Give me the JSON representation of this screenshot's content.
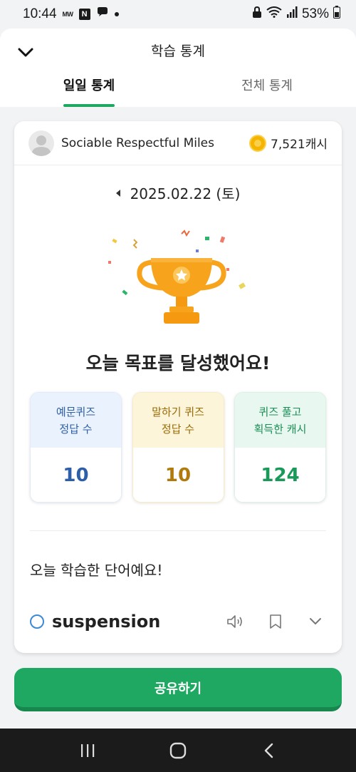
{
  "status_bar": {
    "time": "10:44",
    "mini_label": "MW",
    "n_badge": "N",
    "battery": "53%"
  },
  "header": {
    "title": "학습 통계",
    "tabs": [
      {
        "label": "일일 통계",
        "active": true
      },
      {
        "label": "전체 통계",
        "active": false
      }
    ]
  },
  "user": {
    "name": "Sociable Respectful Miles",
    "cash": "7,521캐시"
  },
  "date": "2025.02.22 (토)",
  "goal_message": "오늘 목표를 달성했어요!",
  "stats": [
    {
      "line1": "예문퀴즈",
      "line2": "정답 수",
      "value": "10",
      "color": "#2d5ea8"
    },
    {
      "line1": "말하기 퀴즈",
      "line2": "정답 수",
      "value": "10",
      "color": "#b07a0c"
    },
    {
      "line1": "퀴즈 풀고",
      "line2": "획득한 캐시",
      "value": "124",
      "color": "#1a9a5a"
    }
  ],
  "words_title": "오늘 학습한 단어예요!",
  "word": {
    "text": "suspension",
    "icons": [
      "speaker-icon",
      "bookmark-icon",
      "chevron-down-icon"
    ]
  },
  "share_button": "공유하기",
  "colors": {
    "accent": "#1fa862",
    "accent_dark": "#17874e",
    "trophy": "#f7a41c"
  }
}
